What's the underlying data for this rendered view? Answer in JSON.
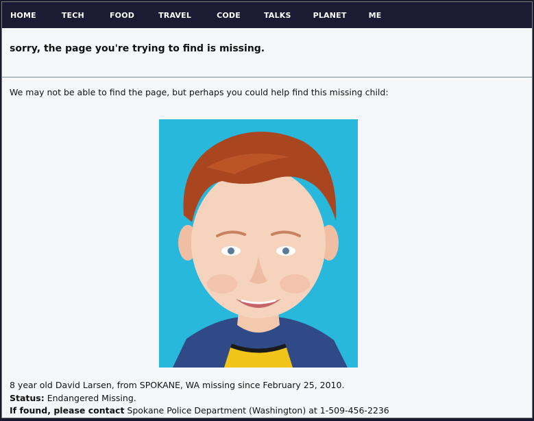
{
  "nav": {
    "items": [
      "HOME",
      "TECH",
      "FOOD",
      "TRAVEL",
      "CODE",
      "TALKS",
      "PLANET",
      "ME"
    ]
  },
  "header": {
    "title": "sorry, the page you're trying to find is missing."
  },
  "content": {
    "intro": "We may not be able to find the page, but perhaps you could help find this missing child:",
    "line1": "8 year old David Larsen, from SPOKANE, WA missing since February 25, 2010.",
    "status_label": "Status:",
    "status_value": "Endangered Missing.",
    "contact_label": "If found, please contact",
    "contact_value": "Spokane Police Department (Washington) at 1-509-456-2236"
  },
  "colors": {
    "nav_bg": "#1b1b33",
    "photo_bg": "#27b8dc"
  }
}
